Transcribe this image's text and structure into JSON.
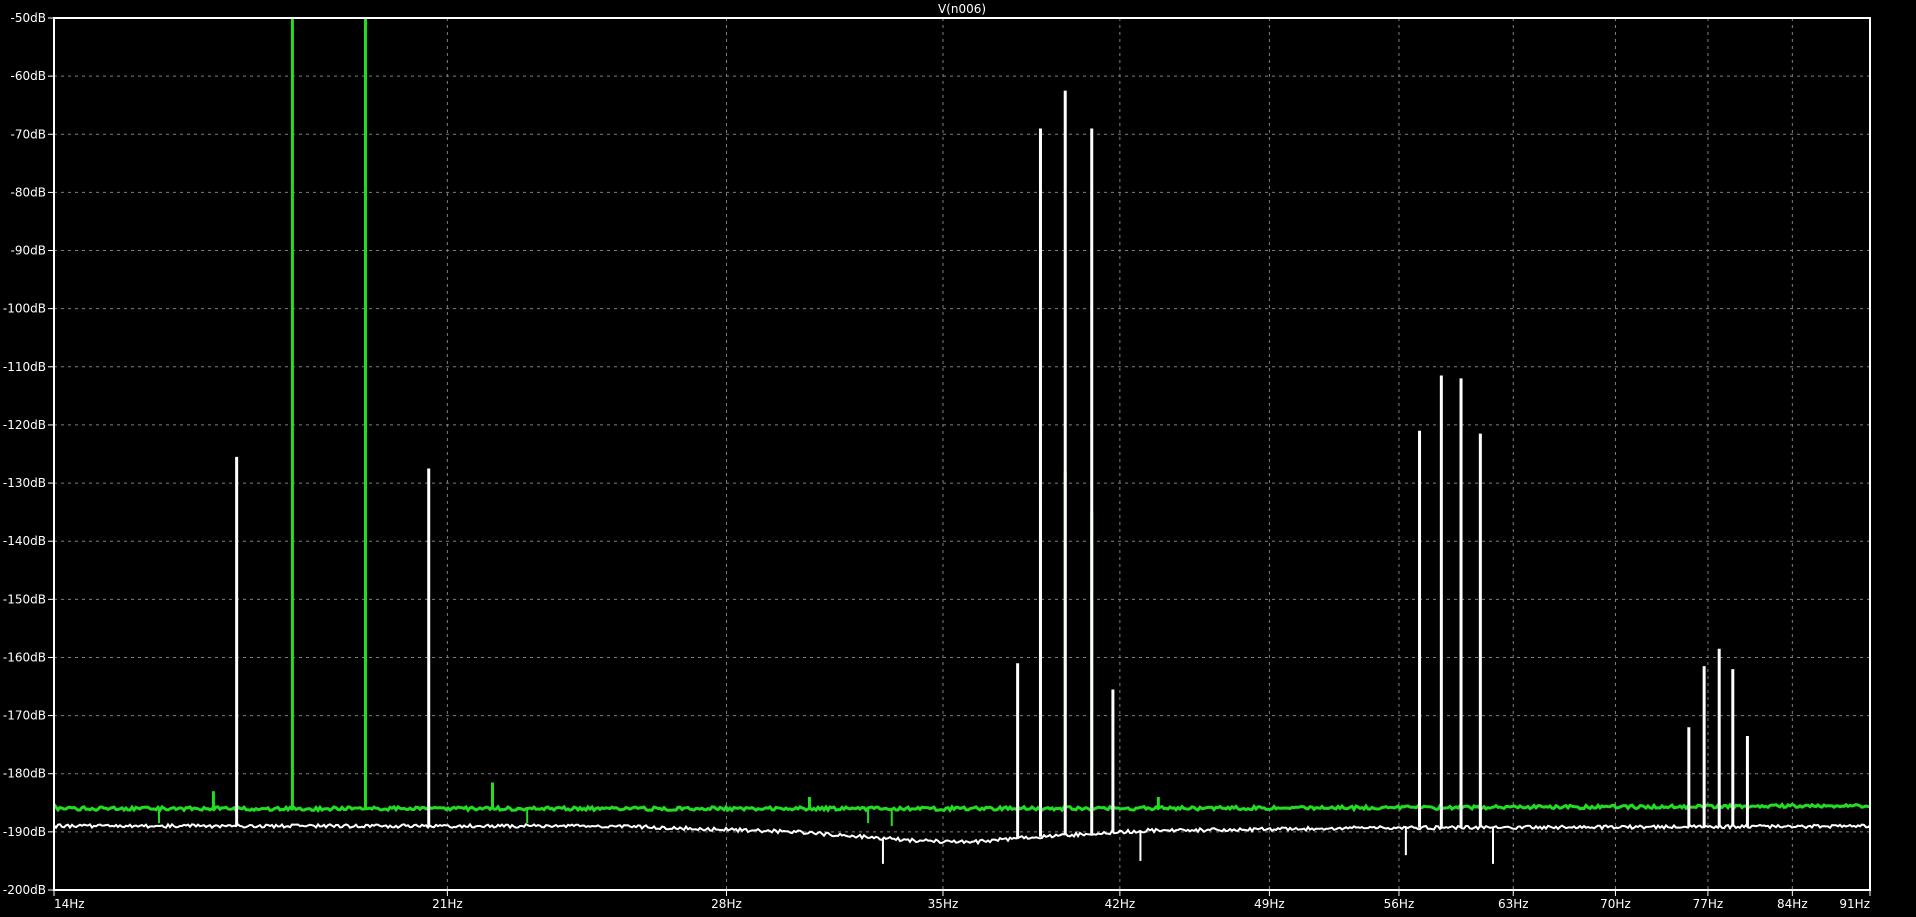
{
  "chart_data": {
    "type": "line",
    "title": "V(n006)",
    "xlabel": "",
    "ylabel": "",
    "x_scale": "log",
    "xlim": [
      14,
      91
    ],
    "ylim": [
      -200,
      -50
    ],
    "grid": true,
    "x_ticks": [
      14,
      21,
      28,
      35,
      42,
      49,
      56,
      63,
      70,
      77,
      84,
      91
    ],
    "x_tick_labels": [
      "14Hz",
      "21Hz",
      "28Hz",
      "35Hz",
      "42Hz",
      "49Hz",
      "56Hz",
      "63Hz",
      "70Hz",
      "77Hz",
      "84Hz",
      "91Hz"
    ],
    "y_ticks": [
      -50,
      -60,
      -70,
      -80,
      -90,
      -100,
      -110,
      -120,
      -130,
      -140,
      -150,
      -160,
      -170,
      -180,
      -190,
      -200
    ],
    "y_tick_labels": [
      "-50dB",
      "-60dB",
      "-70dB",
      "-80dB",
      "-90dB",
      "-100dB",
      "-110dB",
      "-120dB",
      "-130dB",
      "-140dB",
      "-150dB",
      "-160dB",
      "-170dB",
      "-180dB",
      "-190dB",
      "-200dB"
    ],
    "colors": {
      "background": "#000000",
      "frame": "#ffffff",
      "grid": "#7f7f7f",
      "green_trace": "#22dd22",
      "white_trace": "#ffffff"
    },
    "series": [
      {
        "color": "#22dd22",
        "noise_floor": [
          [
            14,
            -186
          ],
          [
            35,
            -186
          ],
          [
            60,
            -185.8
          ],
          [
            91,
            -185.5
          ]
        ],
        "peaks": [
          {
            "x": 16.5,
            "y": -183
          },
          {
            "x": 17.9,
            "y": -50
          },
          {
            "x": 19.3,
            "y": -50
          },
          {
            "x": 22.0,
            "y": -181.5
          },
          {
            "x": 30.5,
            "y": -184
          },
          {
            "x": 38.7,
            "y": -134
          },
          {
            "x": 39.7,
            "y": -128
          },
          {
            "x": 40.8,
            "y": -135
          },
          {
            "x": 43.7,
            "y": -184
          }
        ],
        "dips": [
          {
            "x": 15.6,
            "y": -188.5
          },
          {
            "x": 22.8,
            "y": -188.5
          },
          {
            "x": 32.4,
            "y": -188.5
          },
          {
            "x": 33.2,
            "y": -189
          }
        ]
      },
      {
        "color": "#ffffff",
        "noise_floor": [
          [
            14,
            -189
          ],
          [
            25,
            -189
          ],
          [
            30,
            -190
          ],
          [
            34,
            -191.5
          ],
          [
            36,
            -191.8
          ],
          [
            38,
            -191
          ],
          [
            43,
            -189.8
          ],
          [
            55,
            -189.3
          ],
          [
            91,
            -189
          ]
        ],
        "peaks": [
          {
            "x": 16.9,
            "y": -125.5
          },
          {
            "x": 20.6,
            "y": -127.5
          },
          {
            "x": 37.8,
            "y": -161
          },
          {
            "x": 38.7,
            "y": -69
          },
          {
            "x": 39.7,
            "y": -62.5
          },
          {
            "x": 40.8,
            "y": -69
          },
          {
            "x": 41.7,
            "y": -165.5
          },
          {
            "x": 57.2,
            "y": -121
          },
          {
            "x": 58.5,
            "y": -111.5
          },
          {
            "x": 59.7,
            "y": -112
          },
          {
            "x": 60.9,
            "y": -121.5
          },
          {
            "x": 75.5,
            "y": -172
          },
          {
            "x": 76.7,
            "y": -161.5
          },
          {
            "x": 77.9,
            "y": -158.5
          },
          {
            "x": 79.0,
            "y": -162
          },
          {
            "x": 80.2,
            "y": -173.5
          }
        ],
        "dips": [
          {
            "x": 32.9,
            "y": -195.5
          },
          {
            "x": 42.9,
            "y": -195
          },
          {
            "x": 56.4,
            "y": -194
          },
          {
            "x": 61.7,
            "y": -195.5
          }
        ]
      }
    ]
  }
}
